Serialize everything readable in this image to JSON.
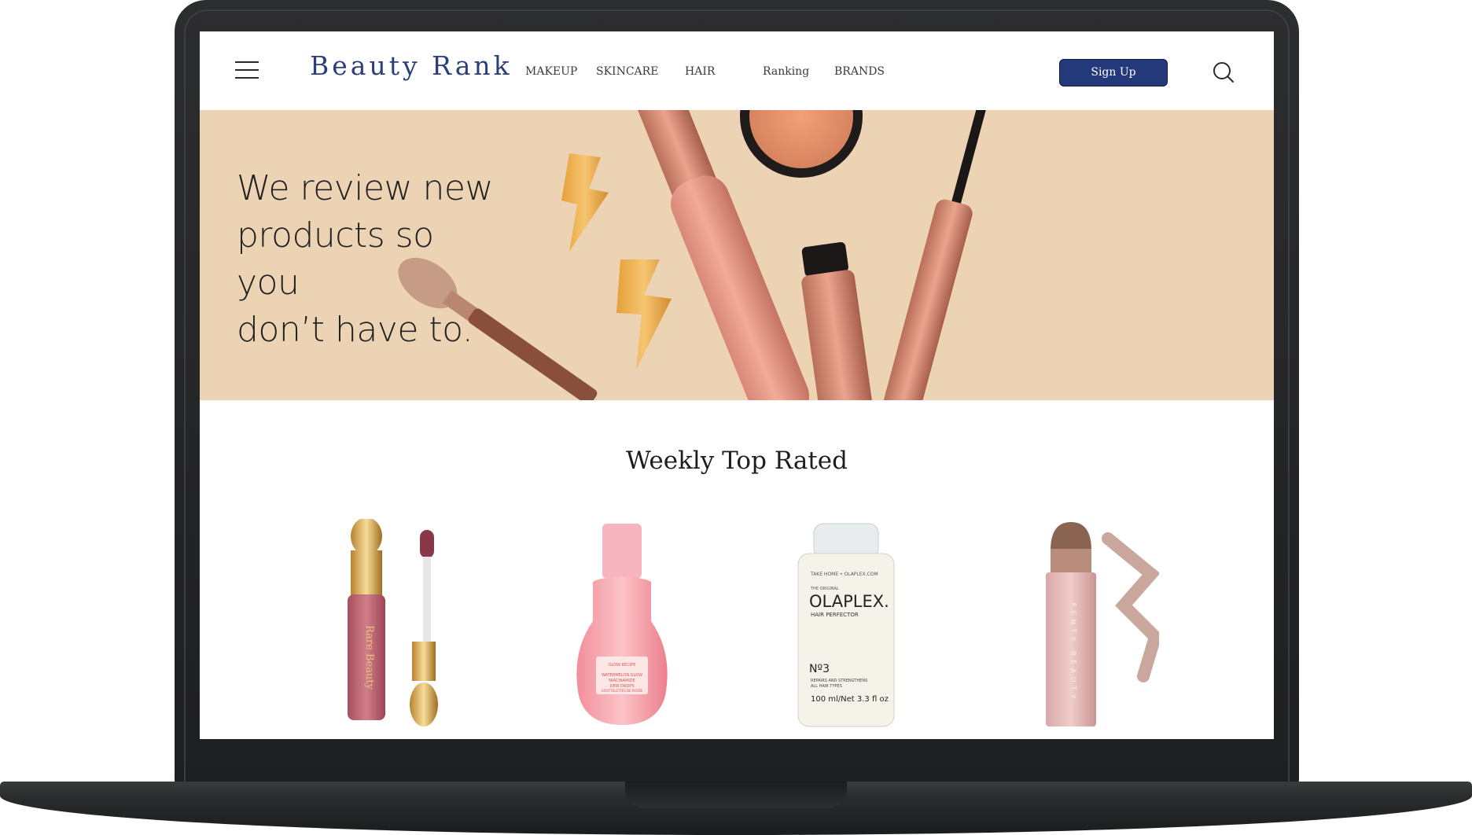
{
  "header": {
    "logo": "Beauty Rank",
    "nav": [
      "MAKEUP",
      "SKINCARE",
      "HAIR",
      "Ranking",
      "BRANDS"
    ],
    "signup_label": "Sign Up"
  },
  "hero": {
    "line1": "We review new",
    "line2": "products so you",
    "line3": "don’t have to."
  },
  "section": {
    "title": "Weekly Top Rated"
  },
  "products": [
    {
      "name": "rare-beauty-liquid-blush",
      "label": "Rare Beauty"
    },
    {
      "name": "glow-recipe-dew-drops",
      "label1": "GLOW RECIPE",
      "label2": "WATERMELON GLOW",
      "label3": "NIACINAMIDE",
      "label4": "DEW DROPS",
      "label5": "GOUTTELETTES DE ROSÉE"
    },
    {
      "name": "olaplex-no3",
      "top": "TAKE HOME • OLAPLEX.COM",
      "orig": "THE ORIGINAL",
      "brand": "OLAPLEX.",
      "sub": "HAIR PERFECTOR",
      "num": "Nº3",
      "desc1": "REPAIRS AND STRENGTHENS",
      "desc2": "ALL HAIR TYPES",
      "size": "100 ml/Net 3.3 fl oz"
    },
    {
      "name": "fenty-beauty-match-stix",
      "label": "FENTY BEAUTY"
    }
  ],
  "colors": {
    "brand": "#2d3f7a",
    "button": "#23397a",
    "hero_bg": "#ebd3b3"
  }
}
